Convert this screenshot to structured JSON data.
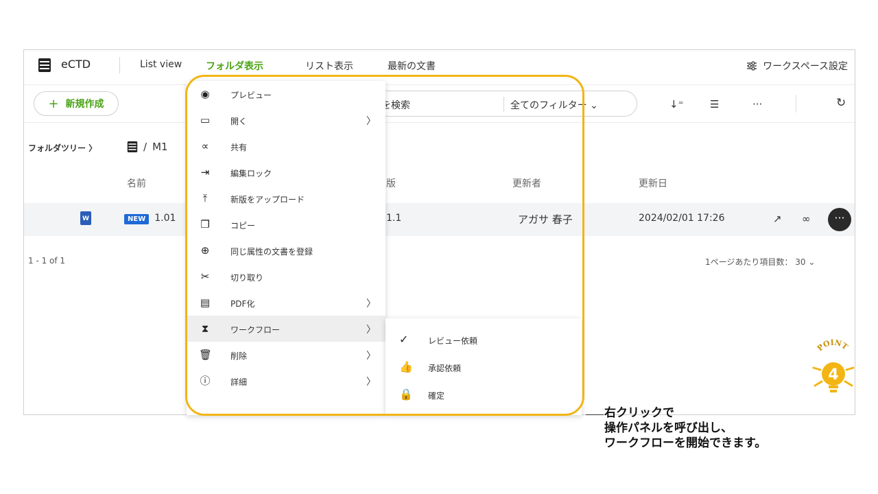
{
  "header": {
    "app_name": "eCTD",
    "nav": [
      "List view",
      "フォルダ表示",
      "リスト表示",
      "最新の文書"
    ],
    "active_nav_index": 1,
    "workspace_settings": "ワークスペース設定"
  },
  "toolbar": {
    "new_label": "新規作成",
    "search_placeholder": "を検索",
    "filter_label": "全てのフィルター",
    "icons": [
      "sort-icon",
      "list-icon",
      "more-horizontal-icon",
      "refresh-icon"
    ]
  },
  "breadcrumb": {
    "tree_label": "フォルダツリー",
    "path_separator": "/",
    "path_segment": "M1"
  },
  "table": {
    "headers": {
      "name": "名前",
      "version": "版",
      "updater": "更新者",
      "updated": "更新日"
    },
    "row": {
      "badge": "NEW",
      "name": "1.01",
      "version": "1.1",
      "updater": "アガサ 春子",
      "updated": "2024/02/01 17:26"
    }
  },
  "pager": {
    "range": "1 - 1 of 1",
    "per_page_label": "1ページあたり項目数：",
    "per_page_value": "30"
  },
  "context_menu": {
    "items": [
      {
        "label": "プレビュー",
        "icon": "eye-icon",
        "submenu": false
      },
      {
        "label": "開く",
        "icon": "laptop-icon",
        "submenu": true
      },
      {
        "label": "共有",
        "icon": "share-icon",
        "submenu": false
      },
      {
        "label": "編集ロック",
        "icon": "login-arrow-icon",
        "submenu": false
      },
      {
        "label": "新版をアップロード",
        "icon": "upload-icon",
        "submenu": false
      },
      {
        "label": "コピー",
        "icon": "copy-icon",
        "submenu": false
      },
      {
        "label": "同じ属性の文書を登録",
        "icon": "file-add-icon",
        "submenu": false
      },
      {
        "label": "切り取り",
        "icon": "scissors-icon",
        "submenu": false
      },
      {
        "label": "PDF化",
        "icon": "pdf-icon",
        "submenu": true
      },
      {
        "label": "ワークフロー",
        "icon": "hourglass-icon",
        "submenu": true
      },
      {
        "label": "削除",
        "icon": "trash-icon",
        "submenu": true
      },
      {
        "label": "詳細",
        "icon": "info-icon",
        "submenu": true
      }
    ],
    "highlighted_index": 9
  },
  "workflow_submenu": {
    "items": [
      {
        "label": "レビュー依頼",
        "icon": "check-icon"
      },
      {
        "label": "承認依頼",
        "icon": "thumbs-up-icon"
      },
      {
        "label": "確定",
        "icon": "lock-icon"
      }
    ]
  },
  "annotation": {
    "line1": "右クリックで",
    "line2": "操作パネルを呼び出し、",
    "line3": "ワークフローを開始できます。",
    "badge_text": "POINT",
    "badge_number": "4",
    "highlight_color": "#f2b514"
  },
  "colors": {
    "accent_green": "#4aa314",
    "new_badge": "#1e6ad6",
    "word_icon": "#2b5db8"
  }
}
